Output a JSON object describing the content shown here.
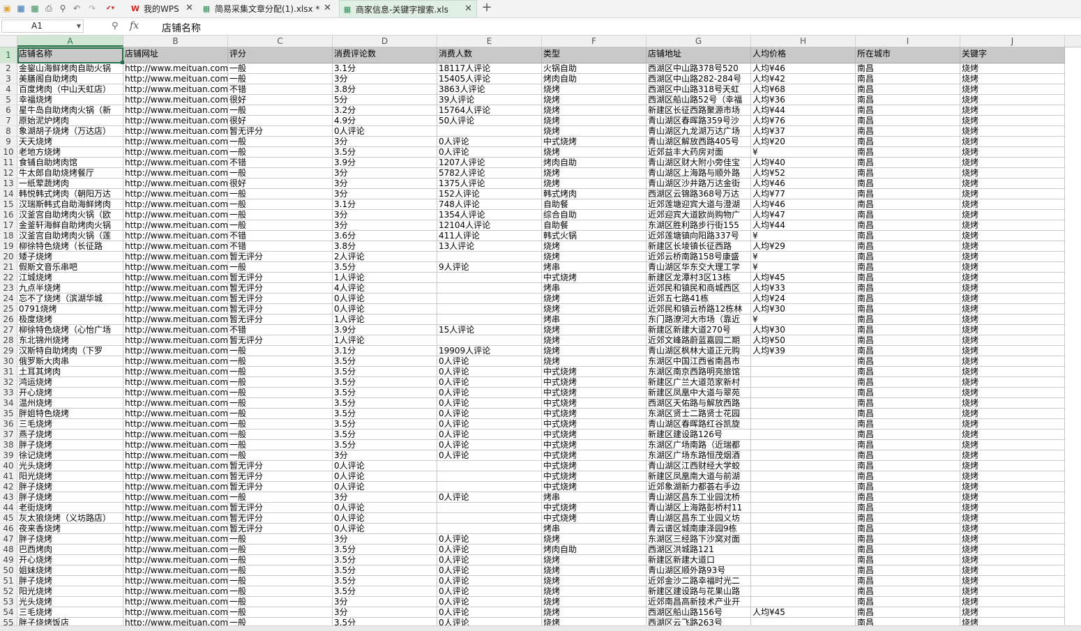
{
  "tabs": [
    {
      "label": "我的WPS",
      "icon": "wps-icon",
      "active": false
    },
    {
      "label": "简易采集文章分配(1).xlsx *",
      "icon": "spreadsheet-icon",
      "active": false
    },
    {
      "label": "商家信息-关键字搜索.xls",
      "icon": "spreadsheet-icon",
      "active": true
    }
  ],
  "formula_bar": {
    "name_box": "A1",
    "fx_label": "fx",
    "content": "店铺名称"
  },
  "columns": [
    "A",
    "B",
    "C",
    "D",
    "E",
    "F",
    "G",
    "H",
    "I",
    "J"
  ],
  "header": [
    "店铺名称",
    "店铺网址",
    "评分",
    "消费评论数",
    "消费人数",
    "类型",
    "店铺地址",
    "人均价格",
    "所在城市",
    "关键字"
  ],
  "rows": [
    [
      "金鋆山海鲜烤肉自助火锅",
      "http://www.meituan.com/",
      "一般",
      "3.1分",
      "18117人评论",
      "火锅自助",
      "西湖区中山路378号520",
      "人均¥46",
      "南昌",
      "烧烤"
    ],
    [
      "美膳阁自助烤肉",
      "http://www.meituan.com/",
      "一般",
      "3分",
      "15405人评论",
      "烤肉自助",
      "西湖区中山路282-284号",
      "人均¥42",
      "南昌",
      "烧烤"
    ],
    [
      "百度烤肉（中山天虹店）",
      "http://www.meituan.com/",
      "不错",
      "3.8分",
      "3863人评论",
      "烧烤",
      "西湖区中山路318号天虹",
      "人均¥68",
      "南昌",
      "烧烤"
    ],
    [
      "幸福烧烤",
      "http://www.meituan.com/",
      "很好",
      "5分",
      "39人评论",
      "烧烤",
      "西湖区船山路52号（幸福",
      "人均¥36",
      "南昌",
      "烧烤"
    ],
    [
      "星牛岛自助烤肉火锅（新",
      "http://www.meituan.com/",
      "一般",
      "3.2分",
      "15764人评论",
      "烧烤",
      "新建区长征西路聚源市场",
      "人均¥44",
      "南昌",
      "烧烤"
    ],
    [
      "原始泥炉烤肉",
      "http://www.meituan.com/",
      "很好",
      "4.9分",
      "50人评论",
      "烧烤",
      "青山湖区春晖路359号沙",
      "人均¥76",
      "南昌",
      "烧烤"
    ],
    [
      "象湖胡子烧烤（万达店）",
      "http://www.meituan.com/",
      "暂无评分",
      "0人评论",
      "",
      "烧烤",
      "青山湖区九龙湖万达广场",
      "人均¥37",
      "南昌",
      "烧烤"
    ],
    [
      "天天烧烤",
      "http://www.meituan.com/",
      "一般",
      "3分",
      "0人评论",
      "中式烧烤",
      "青山湖区解放西路405号",
      "人均¥20",
      "南昌",
      "烧烤"
    ],
    [
      "老地方烧烤",
      "http://www.meituan.com/",
      "一般",
      "3.5分",
      "0人评论",
      "烧烤",
      "近郊益丰大药房对面",
      "¥",
      "南昌",
      "烧烤"
    ],
    [
      "食铺自助烤肉馆",
      "http://www.meituan.com/",
      "不错",
      "3.9分",
      "1207人评论",
      "烤肉自助",
      "青山湖区财大附小旁佳宝",
      "人均¥40",
      "南昌",
      "烧烤"
    ],
    [
      "牛太郎自助烧烤餐厅",
      "http://www.meituan.com/",
      "一般",
      "3分",
      "5782人评论",
      "烧烤",
      "青山湖区上海路与顺外路",
      "人均¥52",
      "南昌",
      "烧烤"
    ],
    [
      "一纸荤蔬烤肉",
      "http://www.meituan.com/",
      "很好",
      "3分",
      "1375人评论",
      "烧烤",
      "青山湖区沙井路万达金街",
      "人均¥46",
      "南昌",
      "烧烤"
    ],
    [
      "韩悦韩式烤肉（朝阳万达",
      "http://www.meituan.com/",
      "一般",
      "3分",
      "152人评论",
      "韩式烤肉",
      "西湖区云锦路368号万达",
      "人均¥77",
      "南昌",
      "烧烤"
    ],
    [
      "汉瑞斯韩式自助海鲜烤肉",
      "http://www.meituan.com/",
      "一般",
      "3.1分",
      "748人评论",
      "自助餐",
      "近郊莲塘迎宾大道与澄湖",
      "人均¥46",
      "南昌",
      "烧烤"
    ],
    [
      "汉釜宫自助烤肉火锅（欧",
      "http://www.meituan.com/",
      "一般",
      "3分",
      "1354人评论",
      "综合自助",
      "近郊迎宾大道欧尚购物广",
      "人均¥47",
      "南昌",
      "烧烤"
    ],
    [
      "金釜轩海鲜自助烤肉火锅",
      "http://www.meituan.com/",
      "一般",
      "3分",
      "12104人评论",
      "自助餐",
      "东湖区胜利路步行街155",
      "人均¥44",
      "南昌",
      "烧烤"
    ],
    [
      "汉釜宫自助烤肉火锅（莲",
      "http://www.meituan.com/",
      "不错",
      "3.6分",
      "411人评论",
      "韩式火锅",
      "近郊莲塘镇向阳路337号",
      "¥",
      "南昌",
      "烧烤"
    ],
    [
      "柳徐特色烧烤（长征路",
      "http://www.meituan.com/",
      "不错",
      "3.8分",
      "13人评论",
      "烧烤",
      "新建区长堎镇长征西路",
      "人均¥29",
      "南昌",
      "烧烤"
    ],
    [
      "矮子烧烤",
      "http://www.meituan.com/",
      "暂无评分",
      "2人评论",
      "",
      "烧烤",
      "近郊云桥南路158号康盛",
      "¥",
      "南昌",
      "烧烤"
    ],
    [
      "假斯文音乐串吧",
      "http://www.meituan.com/",
      "一般",
      "3.5分",
      "9人评论",
      "烤串",
      "青山湖区华东交大理工学",
      "¥",
      "南昌",
      "烧烤"
    ],
    [
      "江城烧烤",
      "http://www.meituan.com/",
      "暂无评分",
      "1人评论",
      "",
      "中式烧烤",
      "新建区龙潭村3区13栋",
      "人均¥45",
      "南昌",
      "烧烤"
    ],
    [
      "九点半烧烤",
      "http://www.meituan.com/",
      "暂无评分",
      "4人评论",
      "",
      "烤串",
      "近郊民和镇民和商城西区",
      "人均¥33",
      "南昌",
      "烧烤"
    ],
    [
      "忘不了烧烤（滨湖华城",
      "http://www.meituan.com/",
      "暂无评分",
      "0人评论",
      "",
      "烧烤",
      "近郊五七路41栋",
      "人均¥24",
      "南昌",
      "烧烤"
    ],
    [
      "0791烧烤",
      "http://www.meituan.com/",
      "暂无评分",
      "0人评论",
      "",
      "烧烤",
      "近郊民和镇云桥路12栋林",
      "人均¥30",
      "南昌",
      "烧烤"
    ],
    [
      "极度烧烤",
      "http://www.meituan.com/",
      "暂无评分",
      "1人评论",
      "",
      "烤串",
      "东门路潦河大市场（靠近",
      "¥",
      "南昌",
      "烧烤"
    ],
    [
      "柳徐特色烧烤（心怡广场",
      "http://www.meituan.com/",
      "不错",
      "3.9分",
      "15人评论",
      "烧烤",
      "新建区新建大道270号",
      "人均¥30",
      "南昌",
      "烧烤"
    ],
    [
      "东北锦州烧烤",
      "http://www.meituan.com/",
      "暂无评分",
      "1人评论",
      "",
      "烧烤",
      "近郊文峰路蔚蓝嘉园二期",
      "人均¥50",
      "南昌",
      "烧烤"
    ],
    [
      "汉斯特自助烤肉（下罗",
      "http://www.meituan.com/",
      "一般",
      "3.1分",
      "19909人评论",
      "烧烤",
      "青山湖区枫林大道正元购",
      "人均¥39",
      "南昌",
      "烧烤"
    ],
    [
      "俄罗斯大肉串",
      "http://www.meituan.com/",
      "一般",
      "3.5分",
      "0人评论",
      "烧烤",
      "东湖区中国江西省南昌市",
      "",
      "南昌",
      "烧烤"
    ],
    [
      "土耳其烤肉",
      "http://www.meituan.com/",
      "一般",
      "3.5分",
      "0人评论",
      "中式烧烤",
      "东湖区南京西路明亮旅馆",
      "",
      "南昌",
      "烧烤"
    ],
    [
      "鸿运烧烤",
      "http://www.meituan.com/",
      "一般",
      "3.5分",
      "0人评论",
      "中式烧烤",
      "新建区广兰大道范家新村",
      "",
      "南昌",
      "烧烤"
    ],
    [
      "开心烧烤",
      "http://www.meituan.com/",
      "一般",
      "3.5分",
      "0人评论",
      "中式烧烤",
      "新建区凤凰中大道与翠苑",
      "",
      "南昌",
      "烧烤"
    ],
    [
      "温州烧烤",
      "http://www.meituan.com/",
      "一般",
      "3.5分",
      "0人评论",
      "中式烧烤",
      "西湖区天佑路与解放西路",
      "",
      "南昌",
      "烧烤"
    ],
    [
      "胖姐特色烧烤",
      "http://www.meituan.com/",
      "一般",
      "3.5分",
      "0人评论",
      "中式烧烤",
      "东湖区贤士二路贤士花园",
      "",
      "南昌",
      "烧烤"
    ],
    [
      "三毛烧烤",
      "http://www.meituan.com/",
      "一般",
      "3.5分",
      "0人评论",
      "中式烧烤",
      "青山湖区春晖路红谷凯旋",
      "",
      "南昌",
      "烧烤"
    ],
    [
      "燕子烧烤",
      "http://www.meituan.com/",
      "一般",
      "3.5分",
      "0人评论",
      "中式烧烤",
      "新建区建设路126号",
      "",
      "南昌",
      "烧烤"
    ],
    [
      "胖子烧烤",
      "http://www.meituan.com/",
      "一般",
      "3.5分",
      "0人评论",
      "中式烧烤",
      "东湖区广场南路（近瑞都",
      "",
      "南昌",
      "烧烤"
    ],
    [
      "徐记烧烤",
      "http://www.meituan.com/",
      "一般",
      "3分",
      "0人评论",
      "中式烧烤",
      "东湖区广场东路恒茂烟酒",
      "",
      "南昌",
      "烧烤"
    ],
    [
      "光头烧烤",
      "http://www.meituan.com/",
      "暂无评分",
      "0人评论",
      "",
      "中式烧烤",
      "青山湖区江西财经大学蛟",
      "",
      "南昌",
      "烧烤"
    ],
    [
      "阳光烧烤",
      "http://www.meituan.com/",
      "暂无评分",
      "0人评论",
      "",
      "中式烧烤",
      "新建区凤凰南大道与前湖",
      "",
      "南昌",
      "烧烤"
    ],
    [
      "胖子烧烤",
      "http://www.meituan.com/",
      "暂无评分",
      "0人评论",
      "",
      "中式烧烤",
      "近郊象湖新力都荟右手边",
      "",
      "南昌",
      "烧烤"
    ],
    [
      "胖子烧烤",
      "http://www.meituan.com/",
      "一般",
      "3分",
      "0人评论",
      "烤串",
      "青山湖区昌东工业园沈桥",
      "",
      "南昌",
      "烧烤"
    ],
    [
      "老街烧烤",
      "http://www.meituan.com/",
      "暂无评分",
      "0人评论",
      "",
      "中式烧烤",
      "青山湖区上海路彭桥村11",
      "",
      "南昌",
      "烧烤"
    ],
    [
      "灰太狼烧烤（义坊路店）",
      "http://www.meituan.com/",
      "暂无评分",
      "0人评论",
      "",
      "中式烧烤",
      "青山湖区昌东工业园义坊",
      "",
      "南昌",
      "烧烤"
    ],
    [
      "夜来香烧烤",
      "http://www.meituan.com/",
      "暂无评分",
      "0人评论",
      "",
      "烤串",
      "青云谱区城南康泽园9栋",
      "",
      "南昌",
      "烧烤"
    ],
    [
      "胖子烧烤",
      "http://www.meituan.com/",
      "一般",
      "3分",
      "0人评论",
      "烧烤",
      "东湖区三经路下沙窝对面",
      "",
      "南昌",
      "烧烤"
    ],
    [
      "巴西烤肉",
      "http://www.meituan.com/",
      "一般",
      "3.5分",
      "0人评论",
      "烤肉自助",
      "西湖区洪城路121",
      "",
      "南昌",
      "烧烤"
    ],
    [
      "开心烧烤",
      "http://www.meituan.com/",
      "一般",
      "3.5分",
      "0人评论",
      "烧烤",
      "新建区新建大道口",
      "",
      "南昌",
      "烧烤"
    ],
    [
      "姐妹烧烤",
      "http://www.meituan.com/",
      "一般",
      "3.5分",
      "0人评论",
      "烧烤",
      "青山湖区顺外路93号",
      "",
      "南昌",
      "烧烤"
    ],
    [
      "胖子烧烤",
      "http://www.meituan.com/",
      "一般",
      "3.5分",
      "0人评论",
      "烧烤",
      "近郊金沙二路幸福时光二",
      "",
      "南昌",
      "烧烤"
    ],
    [
      "阳光烧烤",
      "http://www.meituan.com/",
      "一般",
      "3.5分",
      "0人评论",
      "烧烤",
      "新建区建设路与花果山路",
      "",
      "南昌",
      "烧烤"
    ],
    [
      "光头烧烤",
      "http://www.meituan.com/",
      "一般",
      "3分",
      "0人评论",
      "烧烤",
      "近郊南昌高新技术产业开",
      "",
      "南昌",
      "烧烤"
    ],
    [
      "三毛烧烤",
      "http://www.meituan.com/",
      "一般",
      "3分",
      "0人评论",
      "烧烤",
      "西湖区船山路156号",
      "人均¥45",
      "南昌",
      "烧烤"
    ],
    [
      "胖子烧烤饭店",
      "http://www.meituan.com/",
      "一般",
      "3.5分",
      "0人评论",
      "烧烤",
      "西湖区云飞路263号",
      "",
      "南昌",
      "烧烤"
    ]
  ],
  "selected_cell": "A1",
  "colors": {
    "accent": "#217346",
    "header_fill": "#c9c9c9",
    "active_tab": "#e0efe3"
  }
}
